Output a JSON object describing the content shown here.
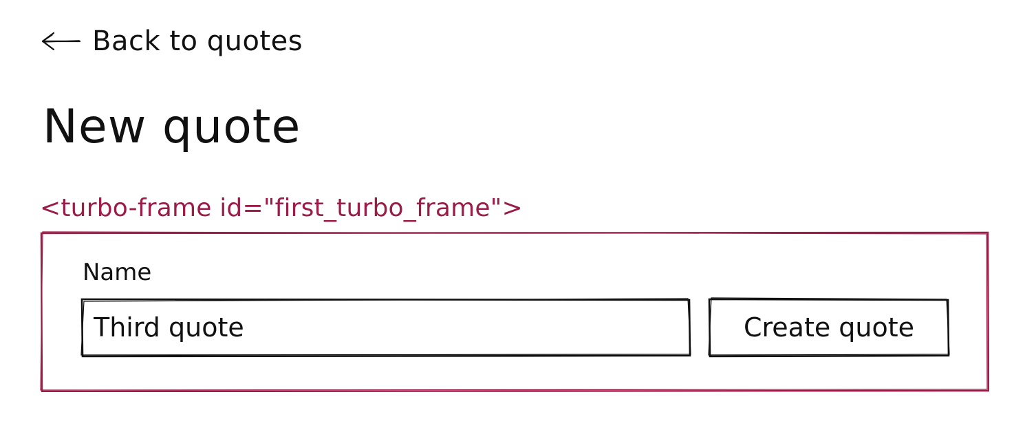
{
  "nav": {
    "back_label": "Back to quotes",
    "back_icon": "left-arrow-icon"
  },
  "page": {
    "title": "New quote"
  },
  "turbo_frame": {
    "tag_label": "<turbo-frame id=\"first_turbo_frame\">",
    "accent_color": "#9b1c47"
  },
  "form": {
    "name_label": "Name",
    "name_value": "Third quote",
    "submit_label": "Create quote"
  }
}
